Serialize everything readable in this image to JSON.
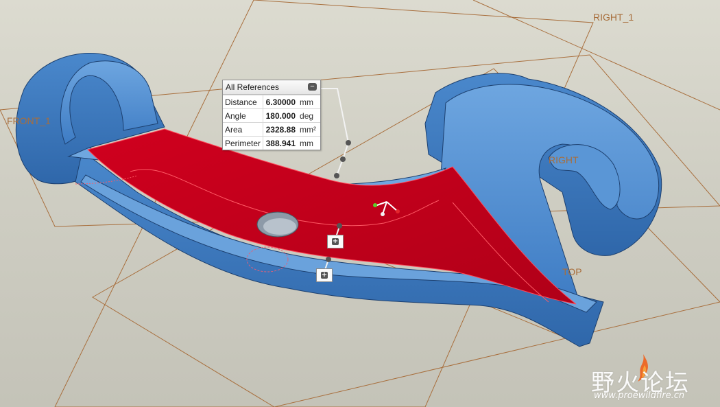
{
  "datums": {
    "right_1": "RIGHT_1",
    "front": "FRONT_1",
    "right": "RIGHT",
    "top": "TOP"
  },
  "measure_panel": {
    "title": "All References",
    "rows": [
      {
        "label": "Distance",
        "value": "6.30000",
        "unit": "mm"
      },
      {
        "label": "Angle",
        "value": "180.000",
        "unit": "deg"
      },
      {
        "label": "Area",
        "value": "2328.88",
        "unit": "mm²"
      },
      {
        "label": "Perimeter",
        "value": "388.941",
        "unit": "mm"
      }
    ]
  },
  "icons": {
    "collapse": "minus-icon",
    "expand": "plus-icon"
  },
  "watermark": {
    "main": "野火论坛",
    "url": "www.proewildfire.cn"
  },
  "colors": {
    "background": "#d4d3c8",
    "part_blue": "#4f8fd3",
    "selected_red": "#c4001c",
    "datum_line": "#a86e3c"
  }
}
